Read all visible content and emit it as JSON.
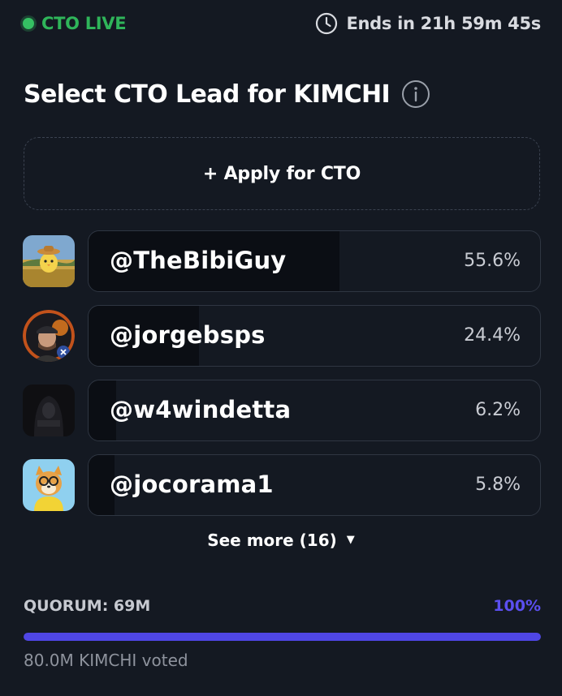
{
  "status": {
    "label": "CTO LIVE",
    "color": "#35c063"
  },
  "timer": {
    "text": "Ends in 21h 59m 45s",
    "icon": "clock-icon"
  },
  "title": "Select CTO Lead for KIMCHI",
  "title_icon": "info-icon",
  "apply_button": "+ Apply for CTO",
  "candidates": [
    {
      "handle": "@TheBibiGuy",
      "percent": "55.6%",
      "share": 0.556,
      "avatar": "cartoon-chick-in-field"
    },
    {
      "handle": "@jorgebsps",
      "percent": "24.4%",
      "share": 0.244,
      "avatar": "man-in-cap-with-bitcoin"
    },
    {
      "handle": "@w4windetta",
      "percent": "6.2%",
      "share": 0.062,
      "avatar": "dark-hooded-figure"
    },
    {
      "handle": "@jocorama1",
      "percent": "5.8%",
      "share": 0.058,
      "avatar": "shiba-dog-with-glasses"
    }
  ],
  "see_more": "See more (16)",
  "quorum": {
    "label": "QUORUM: 69M",
    "percent": "100%",
    "progress": 1.0,
    "accent": "#4f46e5"
  },
  "voted": "80.0M KIMCHI voted"
}
